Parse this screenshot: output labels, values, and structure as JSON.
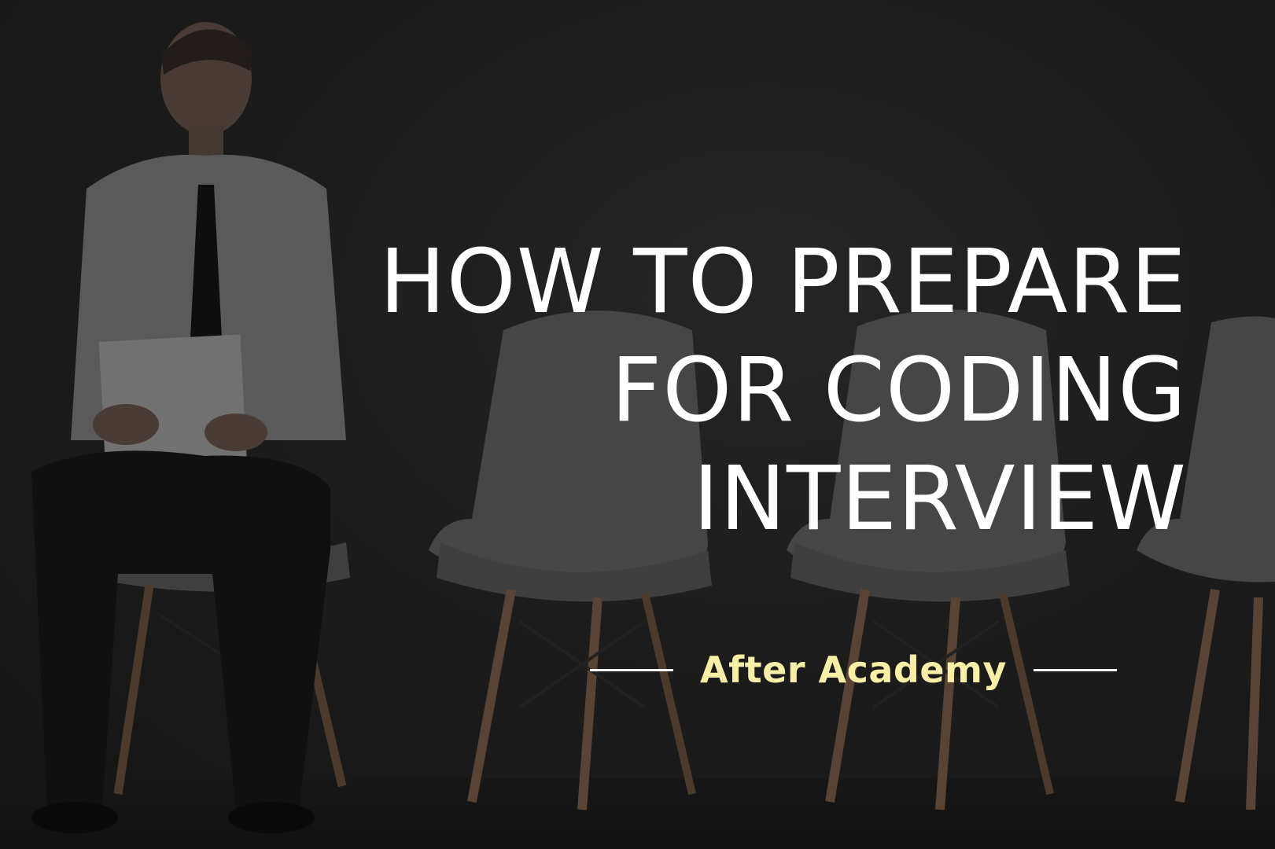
{
  "headline": {
    "line1": "HOW TO PREPARE",
    "line2": "FOR CODING",
    "line3": "INTERVIEW"
  },
  "brand": {
    "name": "After Academy"
  },
  "colors": {
    "background": "#222222",
    "headline": "#ffffff",
    "brand_text": "#f6efa6",
    "chair_shell": "#5a5a5a",
    "chair_legs": "#6b5440"
  }
}
